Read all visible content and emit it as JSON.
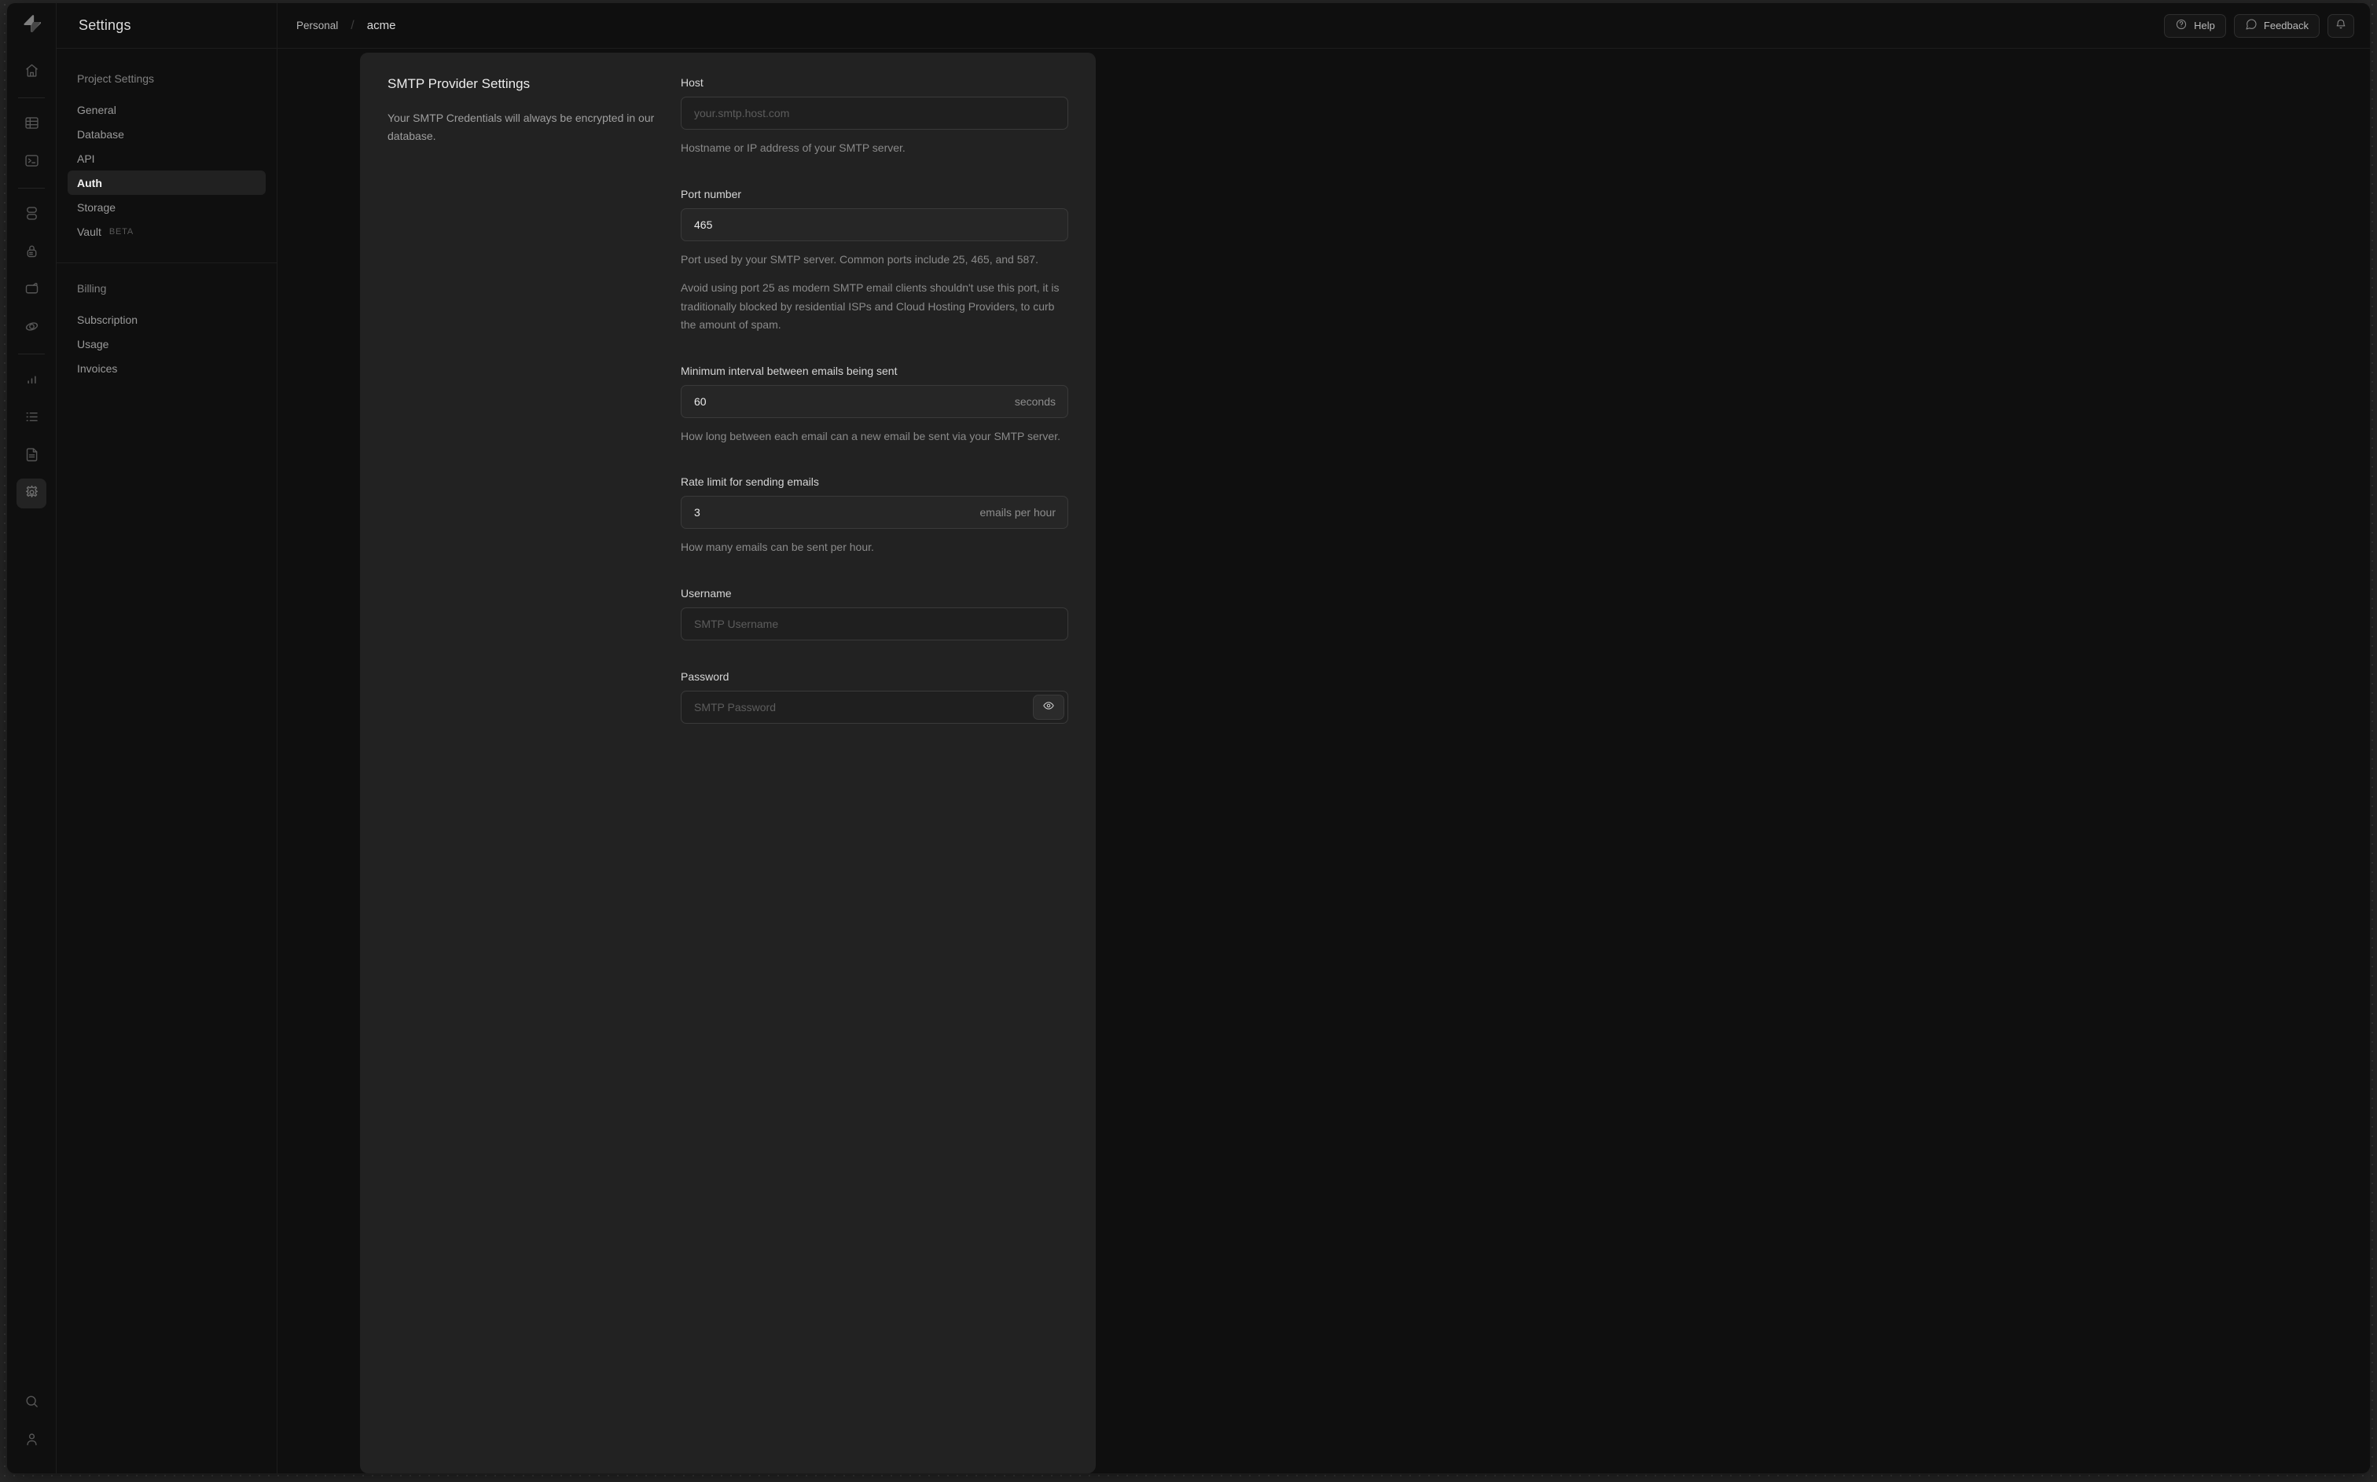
{
  "colors": {
    "desktop_bg": "#282828",
    "window_bg": "#0f0f0f",
    "card_bg": "#222222",
    "active_pill_bg": "#212121"
  },
  "sidebar": {
    "title": "Settings",
    "sections": [
      {
        "label": "Project Settings",
        "items": [
          {
            "label": "General"
          },
          {
            "label": "Database"
          },
          {
            "label": "API"
          },
          {
            "label": "Auth",
            "active": true
          },
          {
            "label": "Storage"
          },
          {
            "label": "Vault",
            "badge": "BETA"
          }
        ]
      },
      {
        "label": "Billing",
        "items": [
          {
            "label": "Subscription"
          },
          {
            "label": "Usage"
          },
          {
            "label": "Invoices"
          }
        ]
      }
    ]
  },
  "header": {
    "breadcrumb": {
      "org": "Personal",
      "separator": "/",
      "project": "acme"
    },
    "help_label": "Help",
    "feedback_label": "Feedback"
  },
  "panel": {
    "title": "SMTP Provider Settings",
    "description": "Your SMTP Credentials will always be encrypted in our database.",
    "fields": {
      "host": {
        "label": "Host",
        "placeholder": "your.smtp.host.com",
        "help": "Hostname or IP address of your SMTP server."
      },
      "port": {
        "label": "Port number",
        "value": "465",
        "help": "Port used by your SMTP server. Common ports include 25, 465, and 587.",
        "note": "Avoid using port 25 as modern SMTP email clients shouldn't use this port, it is traditionally blocked by residential ISPs and Cloud Hosting Providers, to curb the amount of spam."
      },
      "interval": {
        "label": "Minimum interval between emails being sent",
        "value": "60",
        "suffix": "seconds",
        "help": "How long between each email can a new email be sent via your SMTP server."
      },
      "rate": {
        "label": "Rate limit for sending emails",
        "value": "3",
        "suffix": "emails per hour",
        "help": "How many emails can be sent per hour."
      },
      "username": {
        "label": "Username",
        "placeholder": "SMTP Username"
      },
      "password": {
        "label": "Password",
        "placeholder": "SMTP Password"
      }
    }
  }
}
